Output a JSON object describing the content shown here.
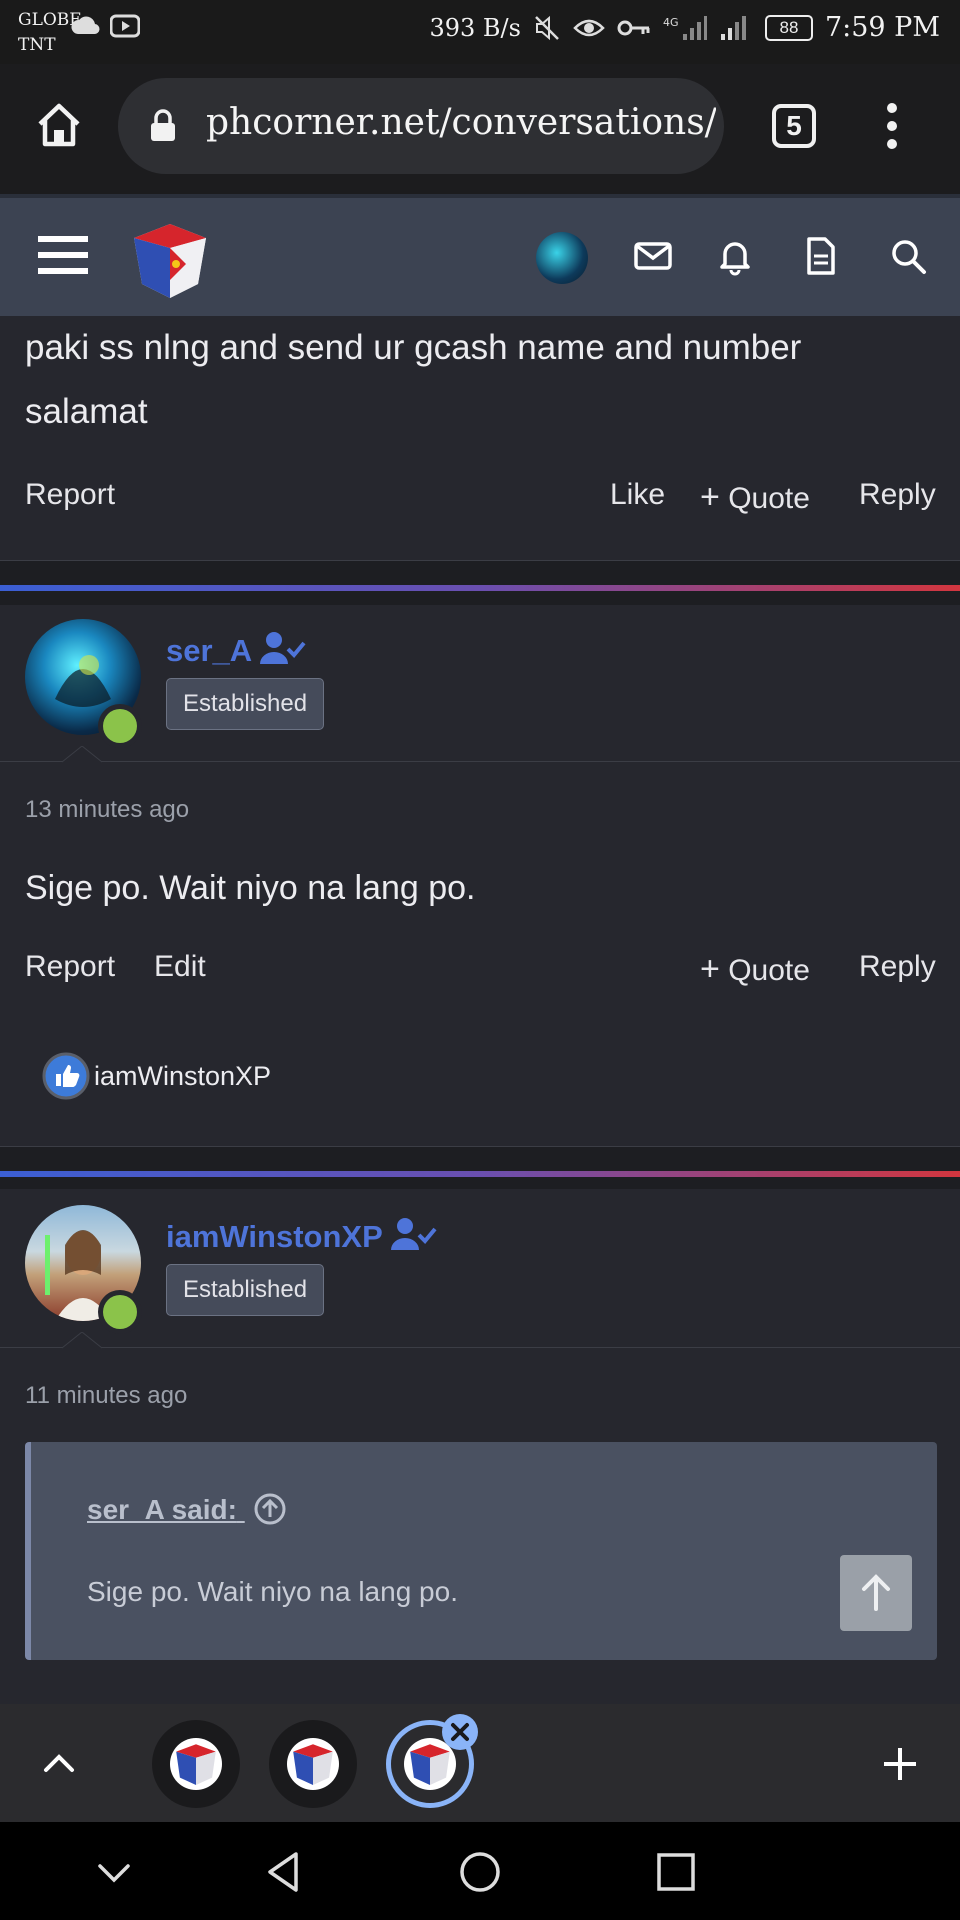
{
  "status_bar": {
    "carrier_top": "GLOBE",
    "carrier_bottom": "TNT",
    "net_speed": "393 B/s",
    "battery": "88",
    "time": "7:59 PM"
  },
  "browser": {
    "url": "phcorner.net/conversations/tnt-lo",
    "tab_count": "5"
  },
  "messages": [
    {
      "text_line1": "paki ss nlng and send ur gcash name and number",
      "text_line2": "salamat",
      "actions": {
        "report": "Report",
        "like": "Like",
        "quote": "Quote",
        "reply": "Reply"
      }
    },
    {
      "username": "ser_A",
      "badge": "Established",
      "time": "13 minutes ago",
      "text": "Sige po. Wait niyo na lang po.",
      "actions": {
        "report": "Report",
        "edit": "Edit",
        "quote": "Quote",
        "reply": "Reply"
      },
      "reaction_user": "iamWinstonXP"
    },
    {
      "username": "iamWinstonXP",
      "badge": "Established",
      "time": "11 minutes ago",
      "quote": {
        "author": "ser_A said:",
        "text": "Sige po. Wait niyo na lang po."
      }
    }
  ],
  "colors": {
    "accent_blue": "#4e74d9",
    "online_green": "#8bc34a",
    "tab_highlight": "#8ab4f8"
  }
}
